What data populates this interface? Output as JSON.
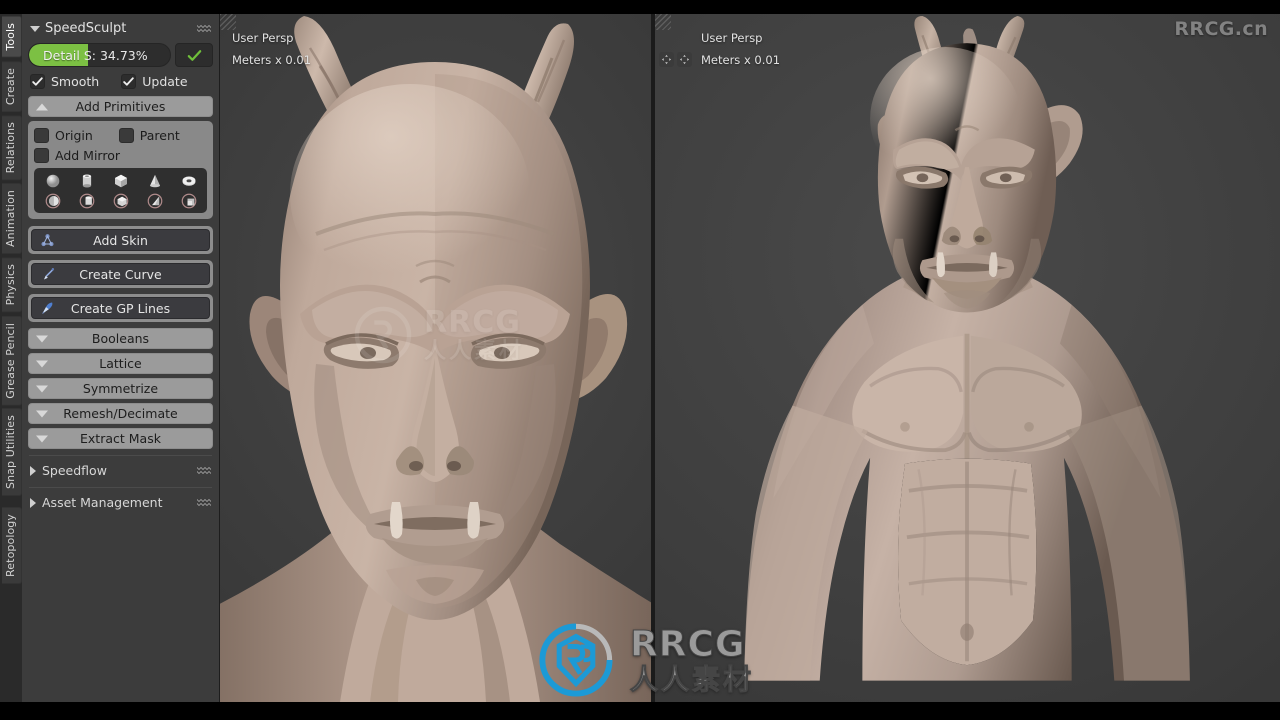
{
  "app": {
    "title": "SpeedSculpt"
  },
  "tabstrip": {
    "items": [
      {
        "label": "Tools",
        "active": true
      },
      {
        "label": "Create",
        "active": false
      },
      {
        "label": "Relations",
        "active": false
      },
      {
        "label": "Animation",
        "active": false
      },
      {
        "label": "Physics",
        "active": false
      },
      {
        "label": "Grease Pencil",
        "active": false
      },
      {
        "label": "Snap Utilities",
        "active": false
      },
      {
        "label": "Retopology",
        "active": false
      }
    ]
  },
  "panel": {
    "header_title": "SpeedSculpt",
    "detail_slider": {
      "label": "Detail",
      "value": "S: 34.73%",
      "fill_percent": 42,
      "fill_color": "#7cc043",
      "confirm_icon": "check-icon",
      "confirm_color": "#6fbf3a"
    },
    "toggles": [
      {
        "label": "Smooth",
        "checked": true
      },
      {
        "label": "Update",
        "checked": true
      }
    ],
    "add_primitives": {
      "label": "Add Primitives",
      "expanded": true,
      "options": [
        {
          "label": "Origin",
          "checked": false
        },
        {
          "label": "Parent",
          "checked": false
        },
        {
          "label": "Add Mirror",
          "checked": false
        }
      ],
      "primitives_row1": [
        "sphere-icon",
        "cylinder-icon",
        "cube-icon",
        "cone-icon",
        "torus-icon"
      ],
      "primitives_row2": [
        "mirror-sphere-icon",
        "mirror-cylinder-icon",
        "mirror-cube-icon",
        "mirror-cone-icon",
        "mirror-torus-icon"
      ]
    },
    "actions": [
      {
        "label": "Add Skin",
        "icon": "skin-icon"
      },
      {
        "label": "Create Curve",
        "icon": "curve-pen-icon"
      },
      {
        "label": "Create GP Lines",
        "icon": "grease-pencil-icon"
      }
    ],
    "collapsibles": [
      {
        "label": "Booleans"
      },
      {
        "label": "Lattice"
      },
      {
        "label": "Symmetrize"
      },
      {
        "label": "Remesh/Decimate"
      },
      {
        "label": "Extract Mask"
      }
    ],
    "sections": [
      {
        "label": "Speedflow",
        "expanded": false
      },
      {
        "label": "Asset Management",
        "expanded": false
      }
    ]
  },
  "viewports": [
    {
      "name": "left-viewport",
      "perspective": "User Persp",
      "units": "Meters x 0.01"
    },
    {
      "name": "right-viewport",
      "perspective": "User Persp",
      "units": "Meters x 0.01"
    }
  ],
  "watermarks": {
    "top_right": "RRCG.cn",
    "center_brand": "RRCG",
    "center_sub": "人人素材"
  },
  "colors": {
    "panel_bg": "#3c3c3c",
    "viewport_bg": "#3a3a3a",
    "accent_green": "#7cc043",
    "button_light": "#9b9b9b",
    "button_dark": "#3b3b3f",
    "sculpt_clay": "#b9a396",
    "logo_blue": "#1c9ad6"
  }
}
